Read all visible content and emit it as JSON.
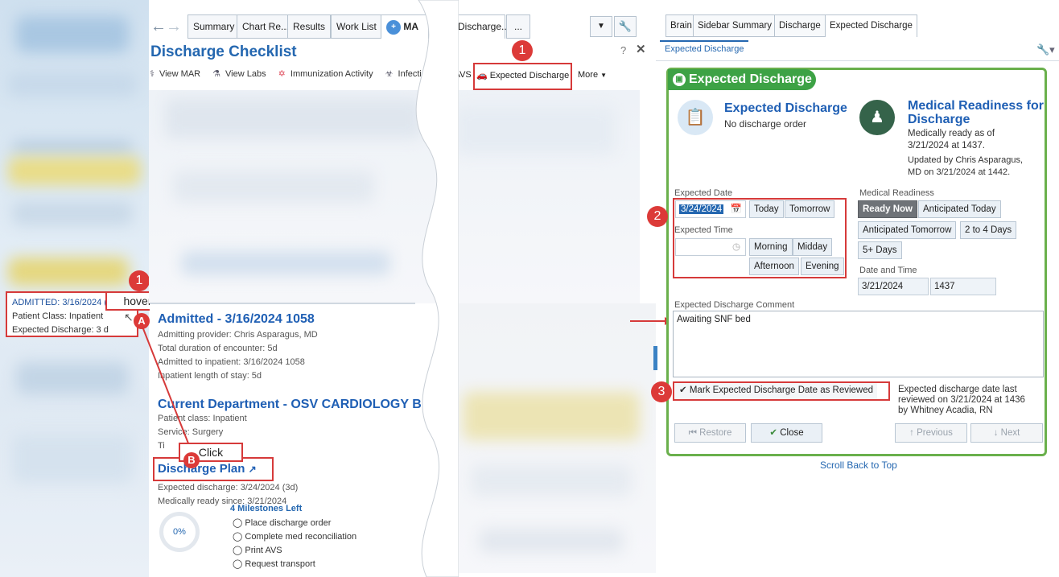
{
  "left_panel": {
    "hover_tip": {
      "admitted": "ADMITTED: 3/16/2024 (",
      "patient_class": "Patient Class: Inpatient",
      "expected_discharge": "Expected Discharge: 3 d"
    },
    "hover_label": "hover",
    "step_1": "1",
    "step_a": "A",
    "step_b": "B",
    "click_label": "Click"
  },
  "chart_tabs": {
    "tabs": [
      "Summary",
      "Chart Re...",
      "Results",
      "Work List",
      "MA",
      "Discharge...",
      "..."
    ]
  },
  "discharge_checklist": {
    "title": "Discharge Checklist",
    "toolbar": [
      "View MAR",
      "View Labs",
      "Immunization Activity",
      "Infectio",
      "d AVS",
      "Expected Discharge",
      "More"
    ],
    "step": "1"
  },
  "chart_card": {
    "admitted_title": "Admitted - 3/16/2024 1058",
    "admitted_lines": [
      "Admitting provider: Chris Asparagus, MD",
      "Total duration of encounter: 5d",
      "Admitted to inpatient: 3/16/2024 1058",
      "Inpatient length of stay: 5d"
    ],
    "dept_title": "Current Department - OSV CARDIOLOGY B",
    "dept_lines": [
      "Patient class: Inpatient",
      "Service: Surgery",
      "Ti"
    ],
    "discharge_plan_title": "Discharge Plan",
    "plan_lines": [
      "Expected discharge: 3/24/2024 (3d)",
      "Medically ready since: 3/21/2024"
    ],
    "progress": "0%",
    "milestones_left": "4 Milestones Left",
    "milestones": [
      "Place discharge order",
      "Complete med reconciliation",
      "Print AVS",
      "Request transport"
    ]
  },
  "right_tabs": {
    "tabs": [
      "Brain",
      "Sidebar Summary",
      "Discharge",
      "Expected Discharge"
    ],
    "sub_tab": "Expected Discharge"
  },
  "expected_discharge": {
    "header": "Expected Discharge",
    "status_title": "Expected Discharge",
    "status_text": "No discharge order",
    "readiness_title": "Medical Readiness for Discharge",
    "readiness_lines": [
      "Medically ready as of",
      "3/21/2024 at 1437.",
      "Updated by Chris Asparagus,",
      "MD on 3/21/2024 at 1442."
    ],
    "expected_date_label": "Expected Date",
    "expected_date_value": "3/24/2024",
    "date_buttons": [
      "Today",
      "Tomorrow"
    ],
    "expected_time_label": "Expected Time",
    "time_buttons": [
      "Morning",
      "Midday",
      "Afternoon",
      "Evening"
    ],
    "medical_readiness_label": "Medical Readiness",
    "readiness_buttons": [
      "Ready Now",
      "Anticipated Today",
      "Anticipated Tomorrow",
      "2 to 4 Days",
      "5+ Days"
    ],
    "date_time_label": "Date and Time",
    "date_value": "3/21/2024",
    "time_value": "1437",
    "comment_label": "Expected Discharge Comment",
    "comment_value": "Awaiting SNF bed",
    "review_button": "Mark Expected Discharge Date as Reviewed",
    "review_note_lines": [
      "Expected discharge date last",
      "reviewed on 3/21/2024 at 1436",
      "by Whitney Acadia, RN"
    ],
    "restore_button": "Restore",
    "close_button": "Close",
    "previous_button": "Previous",
    "next_button": "Next",
    "scroll_top": "Scroll Back to Top",
    "step_2": "2",
    "step_3": "3"
  },
  "colors": {
    "accent_blue": "#2467b0",
    "annotation_red": "#d63a3a",
    "green_header": "#3da245"
  }
}
